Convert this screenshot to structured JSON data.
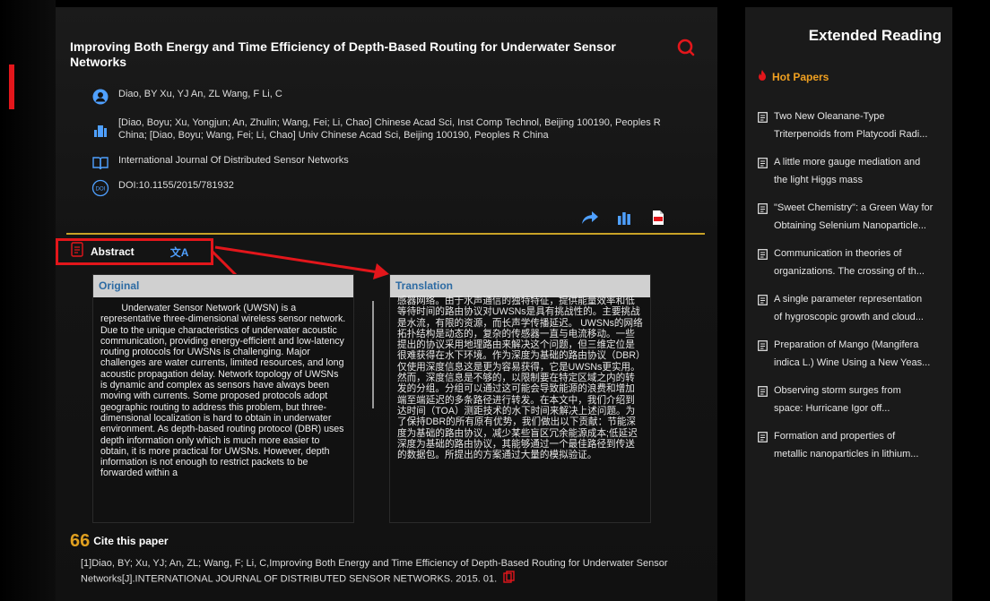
{
  "article": {
    "title": "Improving Both Energy and Time Efficiency of Depth-Based Routing for Underwater Sensor Networks",
    "authors": "Diao, BY   Xu, YJ   An, ZL   Wang, F   Li, C",
    "affiliation": "[Diao, Boyu; Xu, Yongjun; An, Zhulin; Wang, Fei; Li, Chao] Chinese Acad Sci, Inst Comp Technol, Beijing 100190, Peoples R China; [Diao, Boyu; Wang, Fei; Li, Chao] Univ Chinese Acad Sci, Beijing 100190, Peoples R China",
    "journal": "International Journal Of Distributed Sensor Networks",
    "doi": "DOI:10.1155/2015/781932",
    "doi_icon_text": "DOI"
  },
  "abstract": {
    "label": "Abstract",
    "translate_glyph": "文A",
    "original_header": "Original",
    "translation_header": "Translation",
    "original_text": "Underwater Sensor Network (UWSN) is a representative three-dimensional wireless sensor network. Due to the unique characteristics of underwater acoustic communication, providing energy-efficient and low-latency routing protocols for UWSNs is challenging. Major challenges are water currents, limited resources, and long acoustic propagation delay. Network topology of UWSNs is dynamic and complex as sensors have always been moving with currents. Some proposed protocols adopt geographic routing to address this problem, but three-dimensional localization is hard to obtain in underwater environment. As depth-based routing protocol (DBR) uses depth information only which is much more easier to obtain, it is more practical for UWSNs. However, depth information is not enough to restrict packets to be forwarded within a",
    "translation_text": "感器网络。由于水声通信的独特特征，提供能量效率和低等待时间的路由协议对UWSNs是具有挑战性的。主要挑战是水流，有限的资源，而长声学传播延迟。 UWSNs的网络拓扑结构是动态的，复杂的传感器一直与电流移动。一些提出的协议采用地理路由来解决这个问题，但三维定位是很难获得在水下环境。作为深度为基础的路由协议（DBR）仅使用深度信息这是更为容易获得，它是UWSNs更实用。然而，深度信息是不够的，以限制要在特定区域之内的转发的分组。分组可以通过这可能会导致能源的浪费和增加端至端延迟的多条路径进行转发。在本文中，我们介绍到达时间（TOA）测距技术的水下时间来解决上述问题。为了保持DBR的所有原有优势，我们做出以下贡献：节能深度为基础的路由协议，减少某些盲区冗余能源成本;低延迟深度为基础的路由协议，其能够通过一个最佳路径到传送的数据包。所提出的方案通过大量的模拟验证。"
  },
  "cite": {
    "label": "Cite this paper",
    "quote_glyph": "66",
    "text": "[1]Diao, BY; Xu, YJ; An, ZL; Wang, F; Li, C,Improving Both Energy and Time Efficiency of Depth-Based Routing for Underwater Sensor Networks[J].INTERNATIONAL JOURNAL OF DISTRIBUTED SENSOR NETWORKS. 2015. 01."
  },
  "sidebar": {
    "title": "Extended Reading",
    "hot_label": "Hot Papers",
    "items": [
      {
        "line1": "Two New Oleanane-Type",
        "line2": "Triterpenoids from Platycodi Radi..."
      },
      {
        "line1": "A little more gauge mediation and",
        "line2": "the light Higgs mass"
      },
      {
        "line1": "\"Sweet Chemistry\": a Green Way for",
        "line2": "Obtaining Selenium Nanoparticle..."
      },
      {
        "line1": "Communication in theories of",
        "line2": "organizations. The crossing of th..."
      },
      {
        "line1": "A single parameter representation",
        "line2": "of hygroscopic growth and cloud..."
      },
      {
        "line1": "Preparation of Mango (Mangifera",
        "line2": "indica L.) Wine Using a New Yeas..."
      },
      {
        "line1": "Observing storm surges from",
        "line2": "space: Hurricane Igor off..."
      },
      {
        "line1": "Formation and properties of",
        "line2": "metallic nanoparticles in lithium..."
      }
    ]
  },
  "colors": {
    "accent_red": "#e3161b",
    "gold_divider": "#c9a227",
    "hot_orange": "#f0a020",
    "link_blue": "#2d6ba3",
    "icon_blue": "#4fa0ff"
  },
  "icons": [
    "search-icon",
    "user-icon",
    "institution-icon",
    "book-icon",
    "doi-icon",
    "share-icon",
    "stats-icon",
    "pdf-icon",
    "document-icon",
    "translate-icon",
    "quote-icon",
    "fire-icon",
    "paper-icon",
    "copy-icon"
  ]
}
